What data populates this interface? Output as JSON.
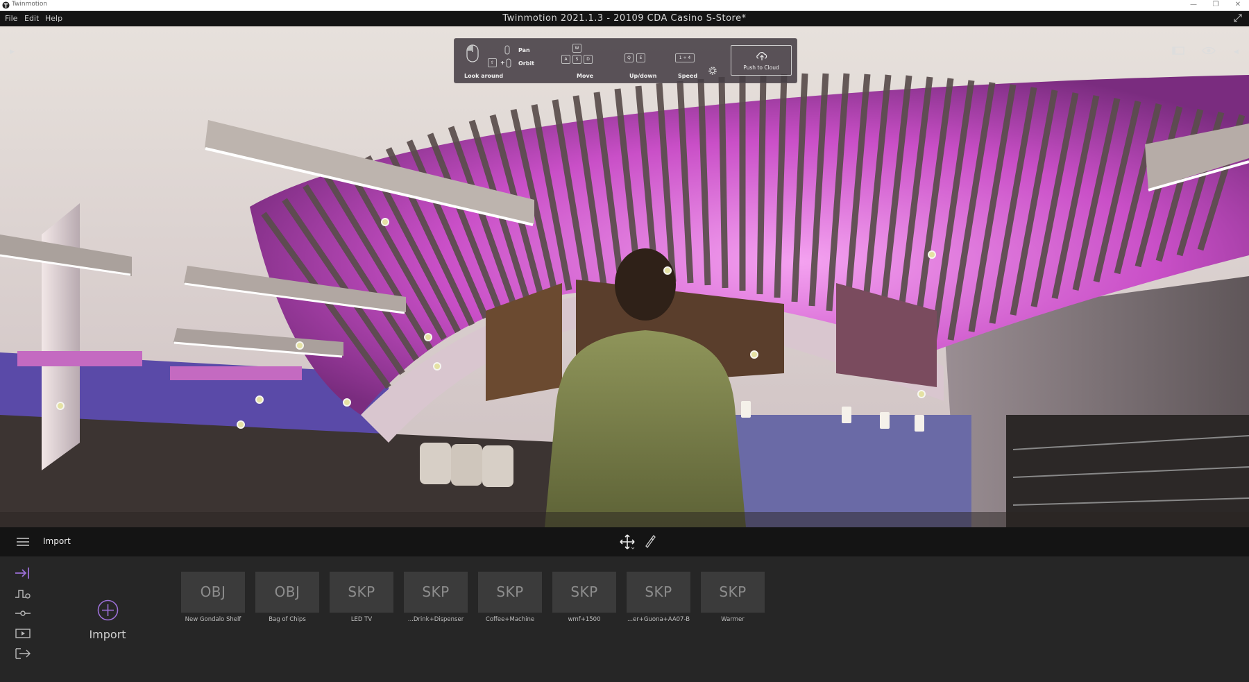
{
  "os": {
    "app_name": "Twinmotion",
    "controls": [
      "—",
      "❐",
      "✕"
    ]
  },
  "menu": {
    "items": [
      "File",
      "Edit",
      "Help"
    ],
    "title": "Twinmotion 2021.1.3 - 20109 CDA Casino S-Store*"
  },
  "nav_panel": {
    "pan": "Pan",
    "orbit": "Orbit",
    "look_around": "Look around",
    "move": "Move",
    "updown": "Up/down",
    "speed": "Speed",
    "speed_keys": "1 ÷ 4",
    "push_to_cloud": "Push to Cloud",
    "keys": {
      "w": "W",
      "a": "A",
      "s": "S",
      "d": "D",
      "q": "Q",
      "e": "E"
    }
  },
  "bottom": {
    "section": "Import"
  },
  "library": {
    "import_label": "Import",
    "assets": [
      {
        "type": "OBJ",
        "name": "New Gondalo Shelf"
      },
      {
        "type": "OBJ",
        "name": "Bag of Chips"
      },
      {
        "type": "SKP",
        "name": "LED TV"
      },
      {
        "type": "SKP",
        "name": "...Drink+Dispenser"
      },
      {
        "type": "SKP",
        "name": "Coffee+Machine"
      },
      {
        "type": "SKP",
        "name": "wmf+1500"
      },
      {
        "type": "SKP",
        "name": "...er+Guona+AA07-B"
      },
      {
        "type": "SKP",
        "name": "Warmer"
      }
    ]
  },
  "colors": {
    "accent": "#9b6fd6",
    "ceiling_light": "#e58ae6"
  }
}
